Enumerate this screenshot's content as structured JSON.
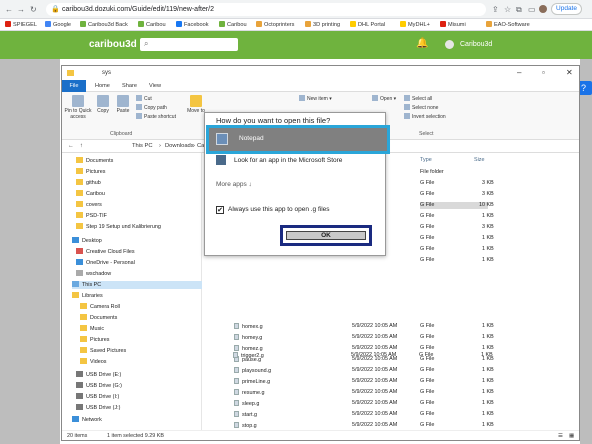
{
  "browser": {
    "url": "caribou3d.dozuki.com/Guide/edit/119/new-after/2",
    "update_label": "Update",
    "bookmarks": [
      "SPIEGEL",
      "Google",
      "Caribou3d Back",
      "Caribou",
      "Facebook",
      "Caribou",
      "Octoprinters",
      "3D printing",
      "DHL Portal",
      "MyDHL+",
      "Misumi",
      "EAO-Software"
    ]
  },
  "site": {
    "logo": "caribou3d",
    "user_name": "Caribou3d"
  },
  "explorer": {
    "window_title": "sys",
    "tabs": [
      "File",
      "Home",
      "Share",
      "View"
    ],
    "ribbon": {
      "pin": "Pin to Quick access",
      "copy": "Copy",
      "paste": "Paste",
      "cut": "Cut",
      "copy_path": "Copy path",
      "paste_shortcut": "Paste shortcut",
      "clipboard_group": "Clipboard",
      "move_to": "Move to",
      "new_item": "New item",
      "open": "Open",
      "select_all": "Select all",
      "select_none": "Select none",
      "invert_selection": "Invert selection",
      "select_group": "Select"
    },
    "address": [
      "This PC",
      "Downloads",
      "Ca"
    ],
    "nav": [
      {
        "label": "Documents"
      },
      {
        "label": "Pictures"
      },
      {
        "label": "github"
      },
      {
        "label": "Caribou"
      },
      {
        "label": "covers"
      },
      {
        "label": "PSD-TIF"
      },
      {
        "label": "Step 19 Setup und Kalibrierung"
      },
      {
        "label": "Desktop"
      },
      {
        "label": "Creative Cloud Files"
      },
      {
        "label": "OneDrive - Personal"
      },
      {
        "label": "wschadow"
      },
      {
        "label": "This PC"
      },
      {
        "label": "Libraries"
      },
      {
        "label": "Camera Roll"
      },
      {
        "label": "Documents"
      },
      {
        "label": "Music"
      },
      {
        "label": "Pictures"
      },
      {
        "label": "Saved Pictures"
      },
      {
        "label": "Videos"
      },
      {
        "label": "USB Drive (E:)"
      },
      {
        "label": "USB Drive (G:)"
      },
      {
        "label": "USB Drive (I:)"
      },
      {
        "label": "USB Drive (J:)"
      },
      {
        "label": "Network"
      }
    ],
    "columns": {
      "type": "Type",
      "size": "Size"
    },
    "upper_rows": [
      {
        "type": "File folder",
        "size": ""
      },
      {
        "type": "G File",
        "size": "3 KB"
      },
      {
        "type": "G File",
        "size": "3 KB"
      },
      {
        "type": "G File",
        "size": "10 KB"
      },
      {
        "type": "G File",
        "size": "1 KB"
      },
      {
        "type": "G File",
        "size": "3 KB"
      },
      {
        "type": "G File",
        "size": "1 KB"
      },
      {
        "type": "G File",
        "size": "1 KB"
      },
      {
        "type": "G File",
        "size": "1 KB"
      }
    ],
    "files": [
      {
        "name": "homex.g",
        "date": "5/9/2022 10:05 AM",
        "type": "G File",
        "size": "1 KB"
      },
      {
        "name": "homey.g",
        "date": "5/9/2022 10:05 AM",
        "type": "G File",
        "size": "1 KB"
      },
      {
        "name": "homez.g",
        "date": "5/9/2022 10:05 AM",
        "type": "G File",
        "size": "1 KB"
      },
      {
        "name": "pause.g",
        "date": "5/9/2022 10:05 AM",
        "type": "G File",
        "size": "1 KB"
      },
      {
        "name": "playsound.g",
        "date": "5/9/2022 10:05 AM",
        "type": "G File",
        "size": "1 KB"
      },
      {
        "name": "primeLine.g",
        "date": "5/9/2022 10:05 AM",
        "type": "G File",
        "size": "1 KB"
      },
      {
        "name": "resume.g",
        "date": "5/9/2022 10:05 AM",
        "type": "G File",
        "size": "1 KB"
      },
      {
        "name": "sleep.g",
        "date": "5/9/2022 10:05 AM",
        "type": "G File",
        "size": "1 KB"
      },
      {
        "name": "start.g",
        "date": "5/9/2022 10:05 AM",
        "type": "G File",
        "size": "1 KB"
      },
      {
        "name": "stop.g",
        "date": "5/9/2022 10:05 AM",
        "type": "G File",
        "size": "1 KB"
      },
      {
        "name": "trigger2.g",
        "date": "5/9/2022 10:05 AM",
        "type": "G File",
        "size": "1 KB"
      }
    ],
    "status_items": "20 items",
    "status_selected": "1 item selected  9.29 KB"
  },
  "dialog": {
    "title": "How do you want to open this file?",
    "app_name": "Notepad",
    "store_option": "Look for an app in the Microsoft Store",
    "more_apps": "More apps ↓",
    "always_use": "Always use this app to open .g files",
    "ok_label": "OK"
  },
  "colors": {
    "site_green": "#6fb33e",
    "highlight_cyan": "#2aa6d9",
    "highlight_navy": "#1a2a80"
  }
}
